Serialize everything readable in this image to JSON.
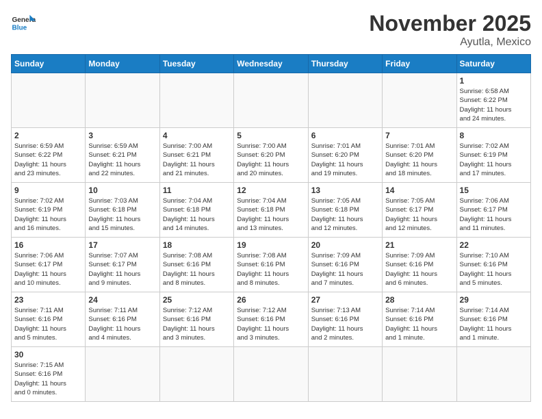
{
  "header": {
    "logo_general": "General",
    "logo_blue": "Blue",
    "month_title": "November 2025",
    "location": "Ayutla, Mexico"
  },
  "days_of_week": [
    "Sunday",
    "Monday",
    "Tuesday",
    "Wednesday",
    "Thursday",
    "Friday",
    "Saturday"
  ],
  "weeks": [
    [
      {
        "day": "",
        "info": ""
      },
      {
        "day": "",
        "info": ""
      },
      {
        "day": "",
        "info": ""
      },
      {
        "day": "",
        "info": ""
      },
      {
        "day": "",
        "info": ""
      },
      {
        "day": "",
        "info": ""
      },
      {
        "day": "1",
        "info": "Sunrise: 6:58 AM\nSunset: 6:22 PM\nDaylight: 11 hours\nand 24 minutes."
      }
    ],
    [
      {
        "day": "2",
        "info": "Sunrise: 6:59 AM\nSunset: 6:22 PM\nDaylight: 11 hours\nand 23 minutes."
      },
      {
        "day": "3",
        "info": "Sunrise: 6:59 AM\nSunset: 6:21 PM\nDaylight: 11 hours\nand 22 minutes."
      },
      {
        "day": "4",
        "info": "Sunrise: 7:00 AM\nSunset: 6:21 PM\nDaylight: 11 hours\nand 21 minutes."
      },
      {
        "day": "5",
        "info": "Sunrise: 7:00 AM\nSunset: 6:20 PM\nDaylight: 11 hours\nand 20 minutes."
      },
      {
        "day": "6",
        "info": "Sunrise: 7:01 AM\nSunset: 6:20 PM\nDaylight: 11 hours\nand 19 minutes."
      },
      {
        "day": "7",
        "info": "Sunrise: 7:01 AM\nSunset: 6:20 PM\nDaylight: 11 hours\nand 18 minutes."
      },
      {
        "day": "8",
        "info": "Sunrise: 7:02 AM\nSunset: 6:19 PM\nDaylight: 11 hours\nand 17 minutes."
      }
    ],
    [
      {
        "day": "9",
        "info": "Sunrise: 7:02 AM\nSunset: 6:19 PM\nDaylight: 11 hours\nand 16 minutes."
      },
      {
        "day": "10",
        "info": "Sunrise: 7:03 AM\nSunset: 6:18 PM\nDaylight: 11 hours\nand 15 minutes."
      },
      {
        "day": "11",
        "info": "Sunrise: 7:04 AM\nSunset: 6:18 PM\nDaylight: 11 hours\nand 14 minutes."
      },
      {
        "day": "12",
        "info": "Sunrise: 7:04 AM\nSunset: 6:18 PM\nDaylight: 11 hours\nand 13 minutes."
      },
      {
        "day": "13",
        "info": "Sunrise: 7:05 AM\nSunset: 6:18 PM\nDaylight: 11 hours\nand 12 minutes."
      },
      {
        "day": "14",
        "info": "Sunrise: 7:05 AM\nSunset: 6:17 PM\nDaylight: 11 hours\nand 12 minutes."
      },
      {
        "day": "15",
        "info": "Sunrise: 7:06 AM\nSunset: 6:17 PM\nDaylight: 11 hours\nand 11 minutes."
      }
    ],
    [
      {
        "day": "16",
        "info": "Sunrise: 7:06 AM\nSunset: 6:17 PM\nDaylight: 11 hours\nand 10 minutes."
      },
      {
        "day": "17",
        "info": "Sunrise: 7:07 AM\nSunset: 6:17 PM\nDaylight: 11 hours\nand 9 minutes."
      },
      {
        "day": "18",
        "info": "Sunrise: 7:08 AM\nSunset: 6:16 PM\nDaylight: 11 hours\nand 8 minutes."
      },
      {
        "day": "19",
        "info": "Sunrise: 7:08 AM\nSunset: 6:16 PM\nDaylight: 11 hours\nand 8 minutes."
      },
      {
        "day": "20",
        "info": "Sunrise: 7:09 AM\nSunset: 6:16 PM\nDaylight: 11 hours\nand 7 minutes."
      },
      {
        "day": "21",
        "info": "Sunrise: 7:09 AM\nSunset: 6:16 PM\nDaylight: 11 hours\nand 6 minutes."
      },
      {
        "day": "22",
        "info": "Sunrise: 7:10 AM\nSunset: 6:16 PM\nDaylight: 11 hours\nand 5 minutes."
      }
    ],
    [
      {
        "day": "23",
        "info": "Sunrise: 7:11 AM\nSunset: 6:16 PM\nDaylight: 11 hours\nand 5 minutes."
      },
      {
        "day": "24",
        "info": "Sunrise: 7:11 AM\nSunset: 6:16 PM\nDaylight: 11 hours\nand 4 minutes."
      },
      {
        "day": "25",
        "info": "Sunrise: 7:12 AM\nSunset: 6:16 PM\nDaylight: 11 hours\nand 3 minutes."
      },
      {
        "day": "26",
        "info": "Sunrise: 7:12 AM\nSunset: 6:16 PM\nDaylight: 11 hours\nand 3 minutes."
      },
      {
        "day": "27",
        "info": "Sunrise: 7:13 AM\nSunset: 6:16 PM\nDaylight: 11 hours\nand 2 minutes."
      },
      {
        "day": "28",
        "info": "Sunrise: 7:14 AM\nSunset: 6:16 PM\nDaylight: 11 hours\nand 1 minute."
      },
      {
        "day": "29",
        "info": "Sunrise: 7:14 AM\nSunset: 6:16 PM\nDaylight: 11 hours\nand 1 minute."
      }
    ],
    [
      {
        "day": "30",
        "info": "Sunrise: 7:15 AM\nSunset: 6:16 PM\nDaylight: 11 hours\nand 0 minutes."
      },
      {
        "day": "",
        "info": ""
      },
      {
        "day": "",
        "info": ""
      },
      {
        "day": "",
        "info": ""
      },
      {
        "day": "",
        "info": ""
      },
      {
        "day": "",
        "info": ""
      },
      {
        "day": "",
        "info": ""
      }
    ]
  ]
}
